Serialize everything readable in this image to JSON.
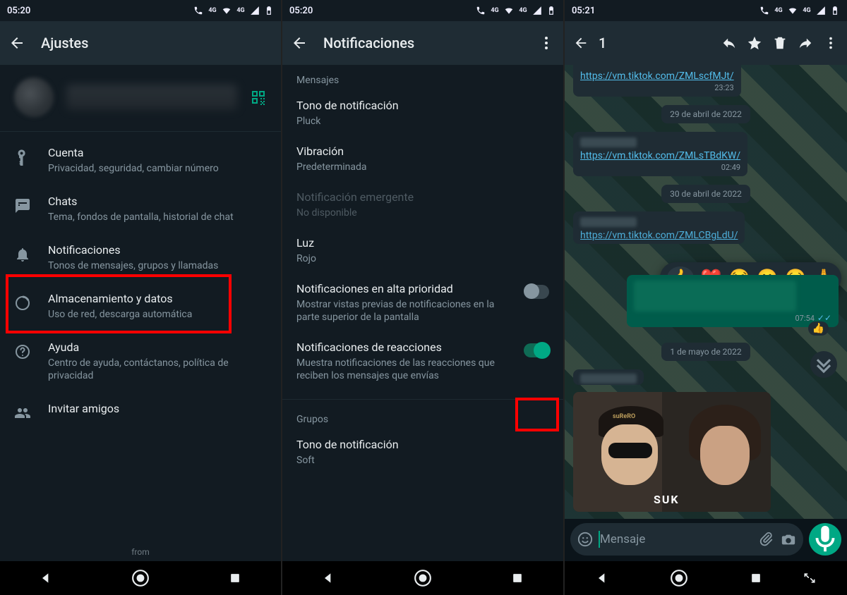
{
  "pane1": {
    "status_time": "05:20",
    "status_net": "4G",
    "title": "Ajustes",
    "items": [
      {
        "icon": "key-icon",
        "title": "Cuenta",
        "subtitle": "Privacidad, seguridad, cambiar número"
      },
      {
        "icon": "chat-icon",
        "title": "Chats",
        "subtitle": "Tema, fondos de pantalla, historial de chat"
      },
      {
        "icon": "bell-icon",
        "title": "Notificaciones",
        "subtitle": "Tonos de mensajes, grupos y llamadas"
      },
      {
        "icon": "data-icon",
        "title": "Almacenamiento y datos",
        "subtitle": "Uso de red, descarga automática"
      },
      {
        "icon": "help-icon",
        "title": "Ayuda",
        "subtitle": "Centro de ayuda, contáctanos, política de privacidad"
      },
      {
        "icon": "people-icon",
        "title": "Invitar amigos",
        "subtitle": ""
      }
    ],
    "footer": "from"
  },
  "pane2": {
    "status_time": "05:20",
    "status_net": "4G",
    "title": "Notificaciones",
    "section_messages": "Mensajes",
    "section_groups": "Grupos",
    "items": [
      {
        "title": "Tono de notificación",
        "subtitle": "Pluck",
        "toggle": null,
        "disabled": false
      },
      {
        "title": "Vibración",
        "subtitle": "Predeterminada",
        "toggle": null,
        "disabled": false
      },
      {
        "title": "Notificación emergente",
        "subtitle": "No disponible",
        "toggle": null,
        "disabled": true
      },
      {
        "title": "Luz",
        "subtitle": "Rojo",
        "toggle": null,
        "disabled": false
      },
      {
        "title": "Notificaciones en alta prioridad",
        "subtitle": "Mostrar vistas previas de notificaciones en la parte superior de la pantalla",
        "toggle": "off",
        "disabled": false
      },
      {
        "title": "Notificaciones de reacciones",
        "subtitle": "Muestra notificaciones de las reacciones que reciben los mensajes que envías",
        "toggle": "on",
        "disabled": false
      }
    ],
    "group_items": [
      {
        "title": "Tono de notificación",
        "subtitle": "Soft"
      }
    ]
  },
  "pane3": {
    "status_time": "05:21",
    "status_net": "4G",
    "selection_count": "1",
    "messages": {
      "m1_link": "https://vm.tiktok.com/ZMLscfMJt/",
      "m1_time": "23:23",
      "date1": "29 de abril de 2022",
      "m2_link": "https://vm.tiktok.com/ZMLsTBdKW/",
      "m2_time": "02:49",
      "date2": "30 de abril de 2022",
      "m3_link": "https://vm.tiktok.com/ZMLCBgLdU/",
      "m3_time_out": "07:54",
      "date3": "1 de mayo de 2022",
      "img_word": "SUK",
      "img_cap": "suReRO"
    },
    "reactions": [
      "👍",
      "❤️",
      "😂",
      "😮",
      "😢",
      "🙏"
    ],
    "mini_reaction": "👍",
    "input_placeholder": "Mensaje"
  }
}
